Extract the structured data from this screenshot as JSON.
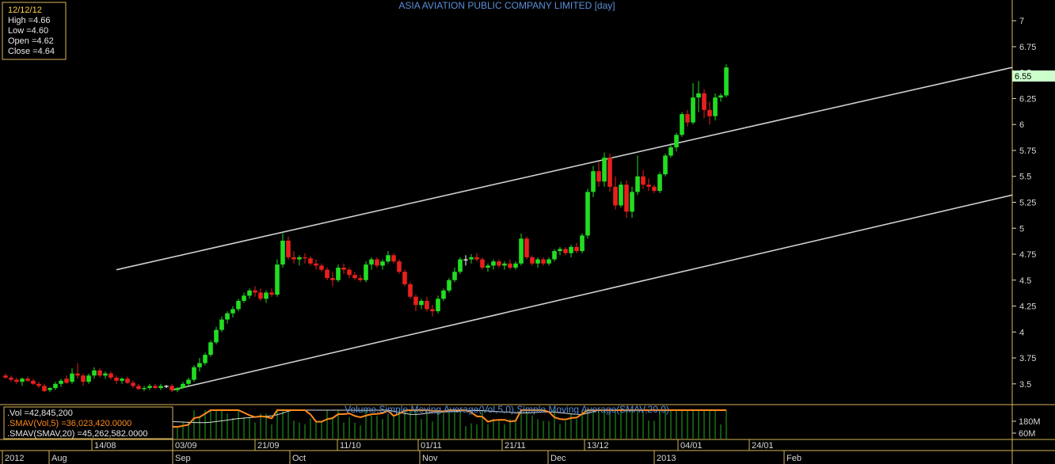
{
  "colors": {
    "background": "#000000",
    "frame": "#d6b45a",
    "up": "#22dd22",
    "down": "#e8201c",
    "doji": "#ffffff",
    "channel": "#cfcfcf",
    "sma5": "#ff8a1c",
    "sma20": "#dddddd",
    "volume_bar": "#1fae1f",
    "last_price_bg": "#ccffcc",
    "title": "#5a8fd8"
  },
  "main": {
    "title": "ASIA AVIATION PUBLIC COMPANY LIMITED [day]",
    "infobox": {
      "date": "12/12/12",
      "high": "High  =4.66",
      "low": "Low   =4.60",
      "open": "Open  =4.62",
      "close": "Close  =4.64"
    },
    "last_price_label": "6.55"
  },
  "volume_panel": {
    "title": "Volume,Simple Moving Average(Vol,5,0),Simple Moving Average(SMAV,20,0)",
    "vol": ".Vol   =42,845,200",
    "smav": ".SMAV(Vol,5)   =36,023,420.0000",
    "smav20": ".SMAV(SMAV,20)   =45,262,582.0000",
    "ticks": [
      "180M",
      "60M"
    ]
  },
  "date_axis": {
    "labels": [
      "2012",
      "Aug",
      "14/08",
      "03/09",
      "Sep",
      "21/09",
      "Oct",
      "11/10",
      "01/11",
      "Nov",
      "21/11",
      "Dec",
      "13/12",
      "2013",
      "04/01",
      "24/01",
      "Feb"
    ]
  },
  "chart_data": {
    "type": "candlestick",
    "title": "ASIA AVIATION PUBLIC COMPANY LIMITED [day]",
    "y_ticks": [
      "3.5",
      "3.75",
      "4",
      "4.25",
      "4.5",
      "4.75",
      "5",
      "5.25",
      "5.5",
      "5.75",
      "6",
      "6.25",
      "6.5",
      "6.75",
      "7"
    ],
    "ylim": [
      3.3,
      7.2
    ],
    "ohlc": [
      [
        3.58,
        3.6,
        3.55,
        3.56
      ],
      [
        3.56,
        3.58,
        3.52,
        3.54
      ],
      [
        3.54,
        3.56,
        3.5,
        3.52
      ],
      [
        3.52,
        3.56,
        3.48,
        3.55
      ],
      [
        3.55,
        3.57,
        3.52,
        3.53
      ],
      [
        3.53,
        3.55,
        3.49,
        3.5
      ],
      [
        3.5,
        3.52,
        3.46,
        3.48
      ],
      [
        3.48,
        3.5,
        3.42,
        3.43
      ],
      [
        3.44,
        3.47,
        3.42,
        3.46
      ],
      [
        3.46,
        3.52,
        3.44,
        3.5
      ],
      [
        3.5,
        3.55,
        3.47,
        3.53
      ],
      [
        3.55,
        3.58,
        3.5,
        3.51
      ],
      [
        3.52,
        3.65,
        3.5,
        3.6
      ],
      [
        3.6,
        3.7,
        3.55,
        3.58
      ],
      [
        3.58,
        3.6,
        3.48,
        3.52
      ],
      [
        3.52,
        3.6,
        3.5,
        3.58
      ],
      [
        3.58,
        3.66,
        3.55,
        3.63
      ],
      [
        3.63,
        3.65,
        3.56,
        3.58
      ],
      [
        3.58,
        3.62,
        3.55,
        3.6
      ],
      [
        3.6,
        3.62,
        3.54,
        3.56
      ],
      [
        3.56,
        3.58,
        3.5,
        3.53
      ],
      [
        3.53,
        3.56,
        3.5,
        3.55
      ],
      [
        3.55,
        3.57,
        3.5,
        3.51
      ],
      [
        3.51,
        3.53,
        3.46,
        3.48
      ],
      [
        3.48,
        3.5,
        3.44,
        3.45
      ],
      [
        3.45,
        3.48,
        3.43,
        3.46
      ],
      [
        3.46,
        3.5,
        3.44,
        3.48
      ],
      [
        3.48,
        3.5,
        3.45,
        3.46
      ],
      [
        3.46,
        3.5,
        3.44,
        3.48
      ],
      [
        3.48,
        3.49,
        3.46,
        3.48
      ],
      [
        3.48,
        3.5,
        3.42,
        3.44
      ],
      [
        3.44,
        3.47,
        3.42,
        3.46
      ],
      [
        3.46,
        3.52,
        3.45,
        3.5
      ],
      [
        3.5,
        3.56,
        3.48,
        3.54
      ],
      [
        3.54,
        3.68,
        3.52,
        3.66
      ],
      [
        3.66,
        3.75,
        3.62,
        3.7
      ],
      [
        3.7,
        3.8,
        3.68,
        3.78
      ],
      [
        3.78,
        3.92,
        3.76,
        3.9
      ],
      [
        3.9,
        4.05,
        3.88,
        4.02
      ],
      [
        4.02,
        4.15,
        4,
        4.12
      ],
      [
        4.12,
        4.2,
        4.08,
        4.18
      ],
      [
        4.18,
        4.25,
        4.14,
        4.22
      ],
      [
        4.22,
        4.32,
        4.2,
        4.3
      ],
      [
        4.3,
        4.38,
        4.28,
        4.35
      ],
      [
        4.35,
        4.42,
        4.32,
        4.4
      ],
      [
        4.4,
        4.44,
        4.34,
        4.38
      ],
      [
        4.38,
        4.42,
        4.3,
        4.32
      ],
      [
        4.32,
        4.4,
        4.28,
        4.38
      ],
      [
        4.38,
        4.42,
        4.34,
        4.36
      ],
      [
        4.36,
        4.7,
        4.34,
        4.65
      ],
      [
        4.65,
        4.95,
        4.62,
        4.88
      ],
      [
        4.88,
        4.92,
        4.7,
        4.72
      ],
      [
        4.72,
        4.78,
        4.66,
        4.7
      ],
      [
        4.7,
        4.74,
        4.64,
        4.72
      ],
      [
        4.72,
        4.76,
        4.66,
        4.71
      ],
      [
        4.71,
        4.73,
        4.64,
        4.66
      ],
      [
        4.66,
        4.7,
        4.6,
        4.64
      ],
      [
        4.64,
        4.66,
        4.58,
        4.6
      ],
      [
        4.6,
        4.62,
        4.5,
        4.52
      ],
      [
        4.52,
        4.58,
        4.44,
        4.5
      ],
      [
        4.5,
        4.65,
        4.48,
        4.62
      ],
      [
        4.62,
        4.66,
        4.56,
        4.6
      ],
      [
        4.6,
        4.62,
        4.52,
        4.55
      ],
      [
        4.55,
        4.58,
        4.5,
        4.52
      ],
      [
        4.52,
        4.55,
        4.48,
        4.5
      ],
      [
        4.5,
        4.68,
        4.48,
        4.65
      ],
      [
        4.65,
        4.72,
        4.6,
        4.7
      ],
      [
        4.7,
        4.72,
        4.62,
        4.64
      ],
      [
        4.64,
        4.7,
        4.6,
        4.68
      ],
      [
        4.68,
        4.78,
        4.66,
        4.74
      ],
      [
        4.74,
        4.76,
        4.66,
        4.68
      ],
      [
        4.68,
        4.7,
        4.56,
        4.58
      ],
      [
        4.58,
        4.6,
        4.44,
        4.46
      ],
      [
        4.46,
        4.48,
        4.32,
        4.34
      ],
      [
        4.34,
        4.36,
        4.2,
        4.26
      ],
      [
        4.26,
        4.32,
        4.22,
        4.3
      ],
      [
        4.3,
        4.34,
        4.2,
        4.22
      ],
      [
        4.22,
        4.26,
        4.15,
        4.2
      ],
      [
        4.2,
        4.35,
        4.18,
        4.32
      ],
      [
        4.32,
        4.42,
        4.3,
        4.4
      ],
      [
        4.4,
        4.52,
        4.38,
        4.5
      ],
      [
        4.5,
        4.62,
        4.48,
        4.58
      ],
      [
        4.58,
        4.72,
        4.56,
        4.7
      ],
      [
        4.7,
        4.74,
        4.64,
        4.7
      ],
      [
        4.7,
        4.75,
        4.66,
        4.72
      ],
      [
        4.72,
        4.76,
        4.68,
        4.7
      ],
      [
        4.7,
        4.72,
        4.6,
        4.62
      ],
      [
        4.62,
        4.66,
        4.58,
        4.64
      ],
      [
        4.64,
        4.7,
        4.6,
        4.68
      ],
      [
        4.68,
        4.7,
        4.62,
        4.64
      ],
      [
        4.64,
        4.68,
        4.6,
        4.66
      ],
      [
        4.66,
        4.7,
        4.6,
        4.62
      ],
      [
        4.62,
        4.68,
        4.6,
        4.66
      ],
      [
        4.66,
        4.95,
        4.64,
        4.9
      ],
      [
        4.9,
        4.92,
        4.7,
        4.72
      ],
      [
        4.72,
        4.74,
        4.64,
        4.66
      ],
      [
        4.66,
        4.72,
        4.62,
        4.7
      ],
      [
        4.7,
        4.72,
        4.64,
        4.66
      ],
      [
        4.66,
        4.72,
        4.64,
        4.7
      ],
      [
        4.7,
        4.8,
        4.68,
        4.78
      ],
      [
        4.78,
        4.82,
        4.74,
        4.8
      ],
      [
        4.8,
        4.82,
        4.74,
        4.76
      ],
      [
        4.76,
        4.84,
        4.72,
        4.82
      ],
      [
        4.82,
        4.86,
        4.76,
        4.78
      ],
      [
        4.78,
        4.95,
        4.76,
        4.93
      ],
      [
        4.93,
        5.38,
        4.9,
        5.35
      ],
      [
        5.35,
        5.6,
        5.3,
        5.55
      ],
      [
        5.55,
        5.64,
        5.4,
        5.45
      ],
      [
        5.45,
        5.73,
        5.4,
        5.68
      ],
      [
        5.68,
        5.72,
        5.35,
        5.4
      ],
      [
        5.4,
        5.5,
        5.18,
        5.22
      ],
      [
        5.22,
        5.45,
        5.2,
        5.42
      ],
      [
        5.42,
        5.46,
        5.1,
        5.16
      ],
      [
        5.16,
        5.4,
        5.1,
        5.35
      ],
      [
        5.35,
        5.7,
        5.32,
        5.5
      ],
      [
        5.5,
        5.56,
        5.38,
        5.42
      ],
      [
        5.42,
        5.48,
        5.36,
        5.4
      ],
      [
        5.4,
        5.42,
        5.34,
        5.36
      ],
      [
        5.36,
        5.54,
        5.34,
        5.52
      ],
      [
        5.52,
        5.72,
        5.5,
        5.7
      ],
      [
        5.7,
        5.82,
        5.68,
        5.78
      ],
      [
        5.78,
        5.92,
        5.74,
        5.9
      ],
      [
        5.9,
        6.12,
        5.88,
        6.1
      ],
      [
        6.1,
        6.14,
        5.98,
        6.02
      ],
      [
        6.02,
        6.4,
        6,
        6.26
      ],
      [
        6.26,
        6.42,
        6.12,
        6.3
      ],
      [
        6.3,
        6.34,
        6.06,
        6.14
      ],
      [
        6.14,
        6.22,
        6,
        6.08
      ],
      [
        6.08,
        6.3,
        6.04,
        6.26
      ],
      [
        6.26,
        6.3,
        6.22,
        6.28
      ],
      [
        6.28,
        6.58,
        6.26,
        6.55
      ]
    ],
    "channel_lines": [
      {
        "name": "upper",
        "x1": 20,
        "y1": 4.6,
        "x2": 146,
        "y2": 6.55
      },
      {
        "name": "lower",
        "x1": 30,
        "y1": 3.44,
        "x2": 146,
        "y2": 5.32
      }
    ]
  }
}
